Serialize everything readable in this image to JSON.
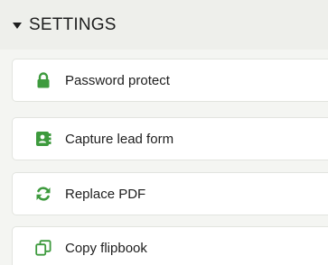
{
  "settings": {
    "title": "SETTINGS",
    "items": [
      {
        "label": "Password protect",
        "icon": "lock-icon",
        "color": "#3d9a3d"
      },
      {
        "label": "Capture lead form",
        "icon": "contact-book-icon",
        "color": "#3d9a3d"
      },
      {
        "label": "Replace PDF",
        "icon": "refresh-icon",
        "color": "#3d9a3d"
      },
      {
        "label": "Copy flipbook",
        "icon": "copy-icon",
        "color": "#3d9a3d"
      }
    ]
  },
  "colors": {
    "accent": "#3d9a3d",
    "header_bg": "#eeefeb",
    "panel_bg": "#f4f5f2",
    "text": "#1e1e1e"
  }
}
